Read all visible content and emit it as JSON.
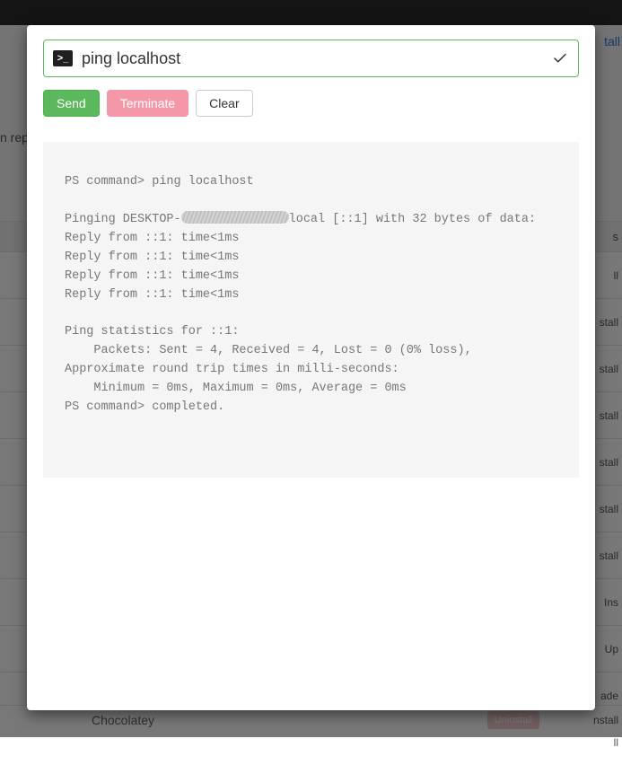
{
  "background": {
    "top_link_fragment": "tall",
    "left_text_fragment": "n rep",
    "header_right": "s",
    "rows": [
      "ll",
      "stall",
      "stall",
      "stall",
      "stall",
      "stall",
      "stall",
      "Ins",
      "Up",
      "ade",
      "ll"
    ],
    "footer_label": "Chocolatey",
    "footer_btn": "Uninstall",
    "footer_right": "nstall"
  },
  "modal": {
    "command_value": "ping localhost",
    "buttons": {
      "send": "Send",
      "terminate": "Terminate",
      "clear": "Clear"
    },
    "output": {
      "line1": "PS command> ping localhost",
      "line2_pre": "Pinging DESKTOP-",
      "line2_post": "local [::1] with 32 bytes of data:",
      "reply": "Reply from ::1: time<1ms",
      "stats_head": "Ping statistics for ::1:",
      "stats_packets": "    Packets: Sent = 4, Received = 4, Lost = 0 (0% loss),",
      "rtt_head": "Approximate round trip times in milli-seconds:",
      "rtt_vals": "    Minimum = 0ms, Maximum = 0ms, Average = 0ms",
      "completed": "PS command> completed."
    }
  }
}
